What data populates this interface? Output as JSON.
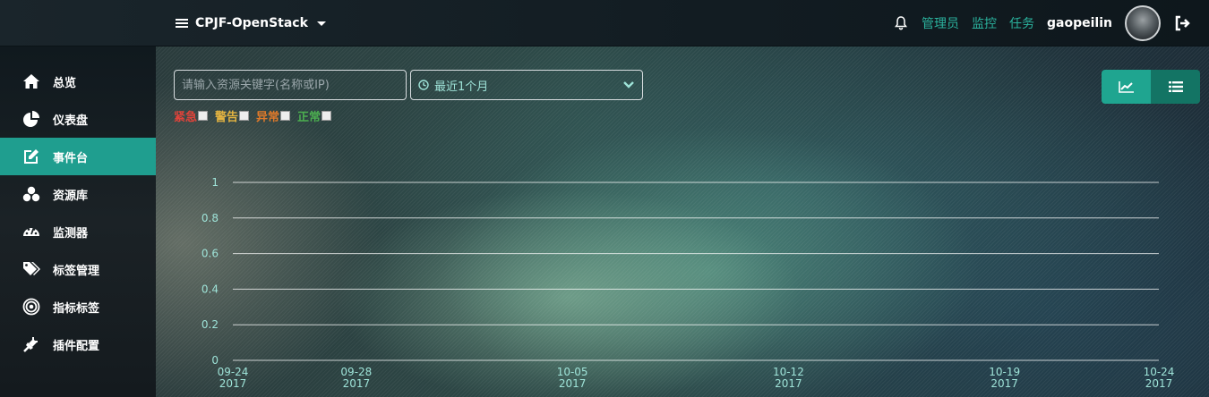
{
  "header": {
    "project_name": "CPJF-OpenStack",
    "nav": [
      "管理员",
      "监控",
      "任务"
    ],
    "username": "gaopeilin"
  },
  "sidebar": {
    "items": [
      {
        "label": "总览",
        "icon": "home-icon"
      },
      {
        "label": "仪表盘",
        "icon": "pie-chart-icon"
      },
      {
        "label": "事件台",
        "icon": "edit-icon",
        "active": true
      },
      {
        "label": "资源库",
        "icon": "cubes-icon"
      },
      {
        "label": "监测器",
        "icon": "dashboard-icon"
      },
      {
        "label": "标签管理",
        "icon": "tags-icon"
      },
      {
        "label": "指标标签",
        "icon": "target-icon"
      },
      {
        "label": "插件配置",
        "icon": "plug-icon"
      }
    ]
  },
  "search": {
    "placeholder": "请输入资源关键字(名称或IP)",
    "value": ""
  },
  "time_range": {
    "selected": "最近1个月"
  },
  "filters": [
    {
      "label": "紧急",
      "color": "#e0433a",
      "checked": false
    },
    {
      "label": "警告",
      "color": "#e3b341",
      "checked": false
    },
    {
      "label": "异常",
      "color": "#e07a2a",
      "checked": false
    },
    {
      "label": "正常",
      "color": "#4caf50",
      "checked": false
    }
  ],
  "colors": {
    "accent": "#1f9e8f",
    "tick_label": "#9ee3d8"
  },
  "chart_data": {
    "type": "line",
    "ylim": [
      0,
      1
    ],
    "y_ticks": [
      "0",
      "0.2",
      "0.4",
      "0.6",
      "0.8",
      "1"
    ],
    "x_ticks": [
      {
        "date": "2017-09-24",
        "label_top": "09-24",
        "label_bottom": "2017"
      },
      {
        "date": "2017-09-28",
        "label_top": "09-28",
        "label_bottom": "2017"
      },
      {
        "date": "2017-10-05",
        "label_top": "10-05",
        "label_bottom": "2017"
      },
      {
        "date": "2017-10-12",
        "label_top": "10-12",
        "label_bottom": "2017"
      },
      {
        "date": "2017-10-19",
        "label_top": "10-19",
        "label_bottom": "2017"
      },
      {
        "date": "2017-10-24",
        "label_top": "10-24",
        "label_bottom": "2017"
      }
    ],
    "xlim": [
      "2017-09-24",
      "2017-10-24"
    ],
    "grid": true,
    "series": []
  }
}
